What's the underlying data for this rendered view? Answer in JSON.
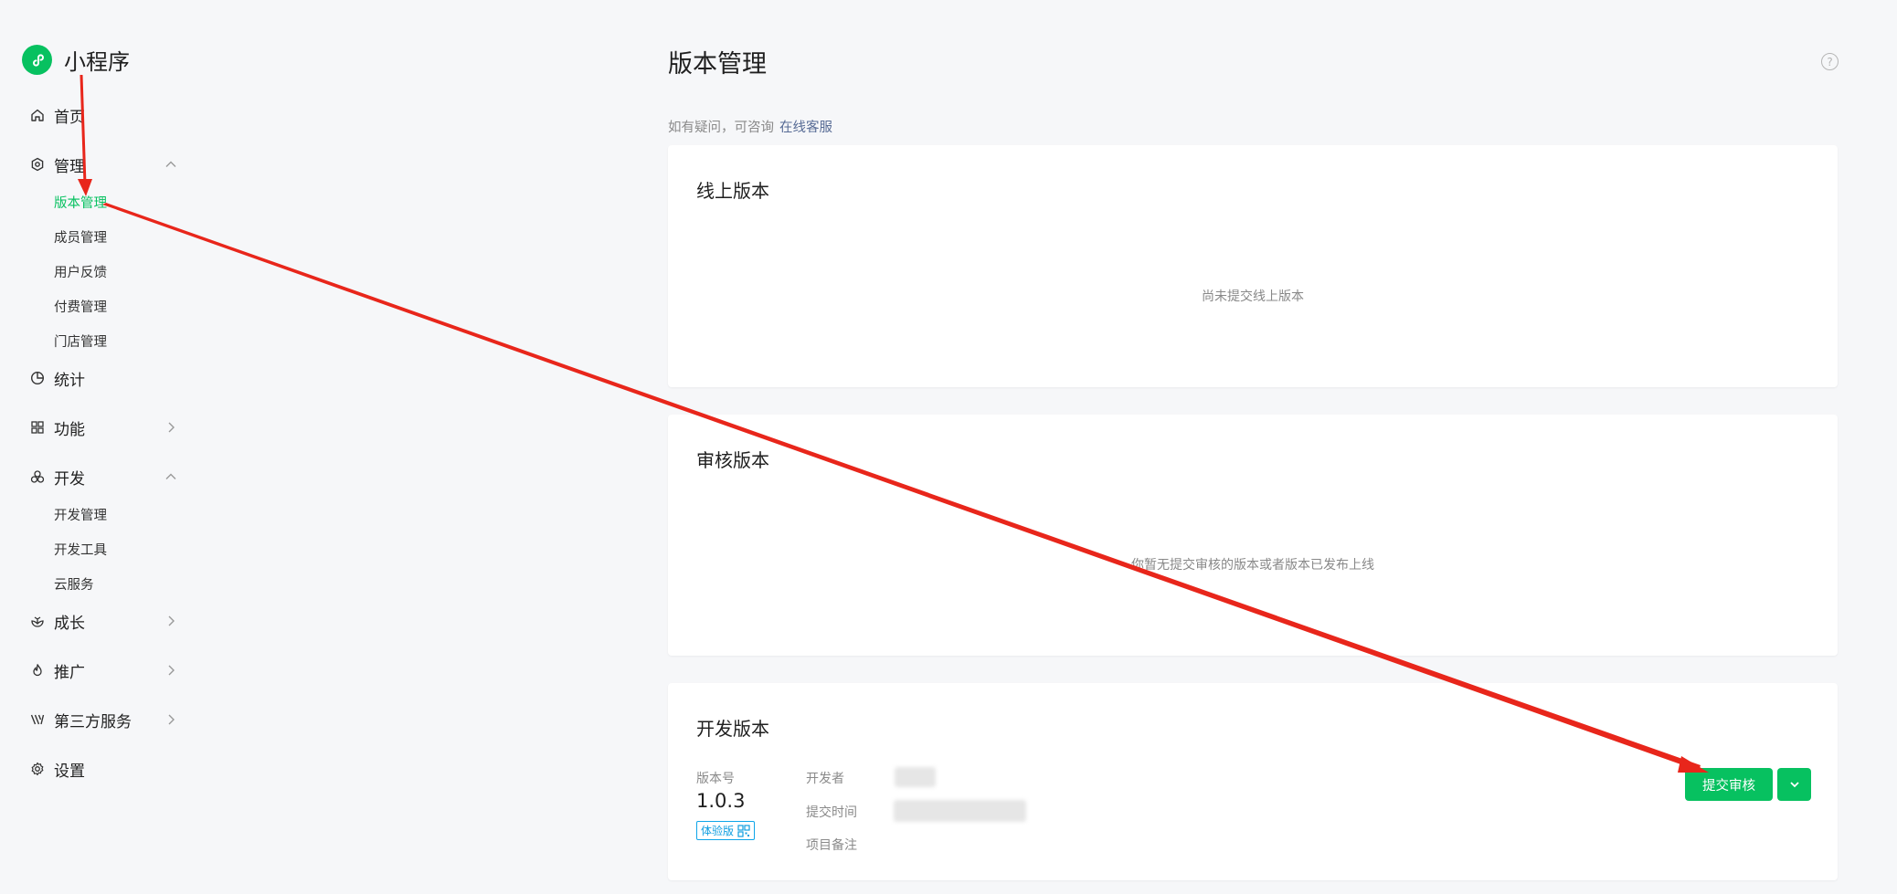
{
  "brand": {
    "title": "小程序"
  },
  "nav": {
    "home": "首页",
    "manage": "管理",
    "manage_items": [
      "版本管理",
      "成员管理",
      "用户反馈",
      "付费管理",
      "门店管理"
    ],
    "stats": "统计",
    "features": "功能",
    "dev": "开发",
    "dev_items": [
      "开发管理",
      "开发工具",
      "云服务"
    ],
    "growth": "成长",
    "promo": "推广",
    "third_party": "第三方服务",
    "settings": "设置"
  },
  "page": {
    "title": "版本管理",
    "hint_text": "如有疑问，可咨询",
    "hint_link": "在线客服"
  },
  "online": {
    "title": "线上版本",
    "empty": "尚未提交线上版本"
  },
  "review": {
    "title": "审核版本",
    "empty": "你暂无提交审核的版本或者版本已发布上线"
  },
  "dev_version": {
    "title": "开发版本",
    "version_label": "版本号",
    "version": "1.0.3",
    "badge": "体验版",
    "developer_label": "开发者",
    "submit_time_label": "提交时间",
    "note_label": "项目备注",
    "submit_button": "提交审核"
  },
  "colors": {
    "accent": "#07c160",
    "link": "#576b95",
    "annotation": "#e8261b"
  }
}
